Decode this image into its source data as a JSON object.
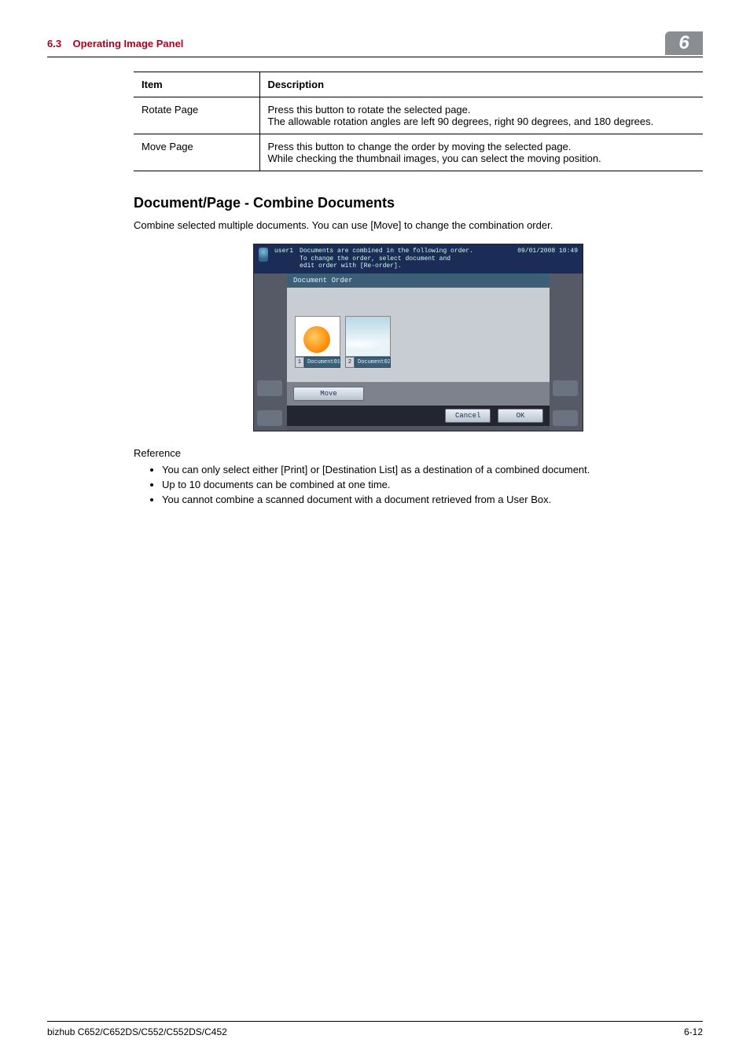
{
  "header": {
    "section_num": "6.3",
    "section_title": "Operating Image Panel",
    "chapter_num": "6"
  },
  "table": {
    "head_item": "Item",
    "head_desc": "Description",
    "rows": [
      {
        "item": "Rotate Page",
        "desc": "Press this button to rotate the selected page.\nThe allowable rotation angles are left 90 degrees, right 90 degrees, and 180 degrees."
      },
      {
        "item": "Move Page",
        "desc": "Press this button to change the order by moving the selected page.\nWhile checking the thumbnail images, you can select the moving position."
      }
    ]
  },
  "subsection": {
    "title": "Document/Page - Combine Documents",
    "intro": "Combine selected multiple documents. You can use [Move] to change the combination order."
  },
  "sim": {
    "user": "user1",
    "msg_l1": "Documents are combined in the following order.",
    "msg_l2": "To change the order, select document and",
    "msg_l3": "edit order with [Re-order].",
    "timestamp": "09/01/2008  10:49",
    "tab": "Document Order",
    "thumbs": [
      {
        "num": "1",
        "name": "Document01"
      },
      {
        "num": "2",
        "name": "Document02"
      }
    ],
    "move": "Move",
    "cancel": "Cancel",
    "ok": "OK"
  },
  "reference": {
    "title": "Reference",
    "items": [
      "You can only select either [Print] or [Destination List] as a destination of a combined document.",
      "Up to 10 documents can be combined at one time.",
      "You cannot combine a scanned document with a document retrieved from a User Box."
    ]
  },
  "footer": {
    "left": "bizhub C652/C652DS/C552/C552DS/C452",
    "right": "6-12"
  }
}
